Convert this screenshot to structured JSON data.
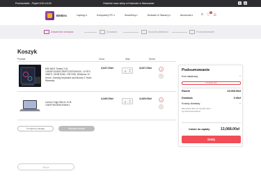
{
  "topbar": {
    "hours": "Poniedziałek - Piątek 9:00-16:00",
    "notice": "Odwiedź nasz sklep w Krakowie w Warszawie",
    "socials": [
      "f",
      "ig"
    ]
  },
  "header": {
    "brand": "Elektro",
    "nav": [
      "Laptopy",
      "Komputery PC",
      "Smartfony",
      "Drukarki & Skanery",
      "Akcesoria"
    ],
    "cart_count": "2",
    "wishlist_count": "0"
  },
  "steps": [
    {
      "label": "Zawartość koszyka",
      "active": true
    },
    {
      "label": "Dostawa",
      "active": false
    },
    {
      "label": "Sposób płatności",
      "active": false
    },
    {
      "label": "Podsumowanie",
      "active": false
    }
  ],
  "cart": {
    "title": "Koszyk",
    "headers": {
      "product": "Produkt",
      "price": "Cena",
      "qty": "Ilość",
      "sum": "Suma"
    },
    "items": [
      {
        "name": "MSI MEG Trident X i5-10400F/32GB/1TB/RTX3070/W10X, 10 RTX 3060Ti, 32GB RAM, 1TB SSD, Windows 10 Home, Gaming Keyboard and Mouse 2 Years Warranty",
        "price": "3,047.00zł",
        "qty": "1",
        "sum": "3,047.00zł"
      },
      {
        "name": "Lenovo Yoga Slim 6-14 i5-1340P/16GB/512/Win11",
        "price": "4,349.00zł",
        "qty": "1",
        "sum": "4,349.00zł"
      }
    ],
    "continue_label": "Kontynuuj zakupy",
    "clear_label": "Wyczyść koszyk"
  },
  "summary": {
    "title": "Podsumowanie",
    "discount_label": "Kod rabatowy",
    "discount_placeholder": "Tu wpisz kod",
    "net_label": "Razem",
    "net_value": "13,068.00zł",
    "delivery_label": "Dostawa",
    "delivery_value": "0.00zł",
    "shipping_label": "Koszty dostawy",
    "shipping_info": "Wprowadź dane do wysyłki celem wyznaczenia kosztów",
    "total_label": "Całość do zapłaty",
    "total_value": "13,068.00zł",
    "pay_label": "Dalej"
  },
  "footer": {
    "back_label": "Wróć"
  },
  "colors": {
    "accent": "#b04b9a",
    "cta": "#f24d56",
    "topbar": "#2d2d31"
  }
}
